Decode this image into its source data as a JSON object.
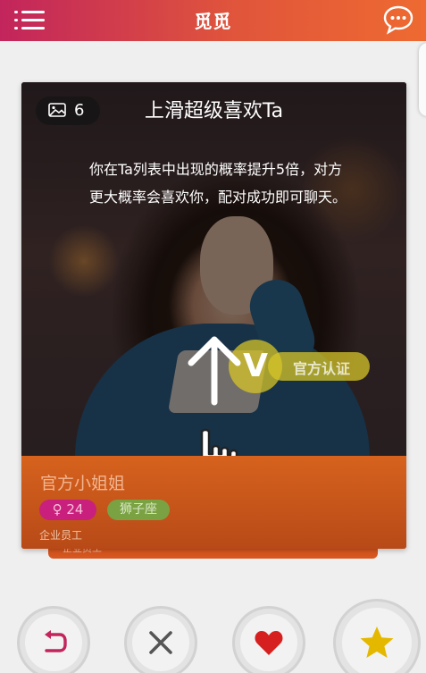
{
  "app": {
    "title": "觅觅",
    "colors": {
      "header_start": "#c2255c",
      "header_end": "#ee6a31",
      "card_info": "#d6621d",
      "gender_tag": "#c8207c",
      "zodiac_tag": "#7aa243",
      "certified": "#d6c428"
    }
  },
  "header": {
    "menu_icon": "menu-icon",
    "chat_icon": "chat-bubble-icon"
  },
  "card": {
    "photo_count": "6",
    "hint_title": "上滑超级喜欢Ta",
    "hint_body": "你在Ta列表中出现的概率提升5倍，对方更大概率会喜欢你，配对成功即可聊天。",
    "certified_mark": "V",
    "certified_label": "官方认证",
    "name": "官方小姐姐",
    "gender_symbol": "♀",
    "age": "24",
    "zodiac": "狮子座",
    "job": "企业员工"
  },
  "back_card": {
    "job": "企业员工"
  },
  "actions": [
    {
      "name": "undo",
      "icon": "undo-arrow-icon"
    },
    {
      "name": "dislike",
      "icon": "close-x-icon"
    },
    {
      "name": "like",
      "icon": "heart-icon"
    },
    {
      "name": "super-like",
      "icon": "star-icon"
    }
  ]
}
